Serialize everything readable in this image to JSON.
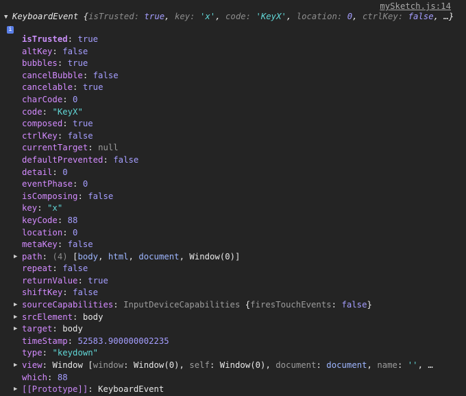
{
  "source_link": "mySketch.js:14",
  "summary": {
    "type": "KeyboardEvent",
    "open": "{",
    "entries": [
      {
        "k": "isTrusted",
        "v": "true",
        "cls": "bool"
      },
      {
        "k": "key",
        "v": "'x'",
        "cls": "str"
      },
      {
        "k": "code",
        "v": "'KeyX'",
        "cls": "str"
      },
      {
        "k": "location",
        "v": "0",
        "cls": "num"
      },
      {
        "k": "ctrlKey",
        "v": "false",
        "cls": "bool"
      }
    ],
    "ellipsis": "…}",
    "info": "i"
  },
  "rows": [
    {
      "key": "isTrusted",
      "own": true,
      "parts": [
        {
          "t": "true",
          "c": "bool"
        }
      ]
    },
    {
      "key": "altKey",
      "parts": [
        {
          "t": "false",
          "c": "bool"
        }
      ]
    },
    {
      "key": "bubbles",
      "parts": [
        {
          "t": "true",
          "c": "bool"
        }
      ]
    },
    {
      "key": "cancelBubble",
      "parts": [
        {
          "t": "false",
          "c": "bool"
        }
      ]
    },
    {
      "key": "cancelable",
      "parts": [
        {
          "t": "true",
          "c": "bool"
        }
      ]
    },
    {
      "key": "charCode",
      "parts": [
        {
          "t": "0",
          "c": "num"
        }
      ]
    },
    {
      "key": "code",
      "parts": [
        {
          "t": "\"KeyX\"",
          "c": "str"
        }
      ]
    },
    {
      "key": "composed",
      "parts": [
        {
          "t": "true",
          "c": "bool"
        }
      ]
    },
    {
      "key": "ctrlKey",
      "parts": [
        {
          "t": "false",
          "c": "bool"
        }
      ]
    },
    {
      "key": "currentTarget",
      "parts": [
        {
          "t": "null",
          "c": "null"
        }
      ]
    },
    {
      "key": "defaultPrevented",
      "parts": [
        {
          "t": "false",
          "c": "bool"
        }
      ]
    },
    {
      "key": "detail",
      "parts": [
        {
          "t": "0",
          "c": "num"
        }
      ]
    },
    {
      "key": "eventPhase",
      "parts": [
        {
          "t": "0",
          "c": "num"
        }
      ]
    },
    {
      "key": "isComposing",
      "parts": [
        {
          "t": "false",
          "c": "bool"
        }
      ]
    },
    {
      "key": "key",
      "parts": [
        {
          "t": "\"x\"",
          "c": "str"
        }
      ]
    },
    {
      "key": "keyCode",
      "parts": [
        {
          "t": "88",
          "c": "num"
        }
      ]
    },
    {
      "key": "location",
      "parts": [
        {
          "t": "0",
          "c": "num"
        }
      ]
    },
    {
      "key": "metaKey",
      "parts": [
        {
          "t": "false",
          "c": "bool"
        }
      ]
    },
    {
      "key": "path",
      "expandable": true,
      "parts": [
        {
          "t": "(4) ",
          "c": "meta"
        },
        {
          "t": "[",
          "c": "punc"
        },
        {
          "t": "body",
          "c": "lnk"
        },
        {
          "t": ", ",
          "c": "punc"
        },
        {
          "t": "html",
          "c": "lnk"
        },
        {
          "t": ", ",
          "c": "punc"
        },
        {
          "t": "document",
          "c": "lnk"
        },
        {
          "t": ", ",
          "c": "punc"
        },
        {
          "t": "Window(0)",
          "c": "obj"
        },
        {
          "t": "]",
          "c": "punc"
        }
      ]
    },
    {
      "key": "repeat",
      "parts": [
        {
          "t": "false",
          "c": "bool"
        }
      ]
    },
    {
      "key": "returnValue",
      "parts": [
        {
          "t": "true",
          "c": "bool"
        }
      ]
    },
    {
      "key": "shiftKey",
      "parts": [
        {
          "t": "false",
          "c": "bool"
        }
      ]
    },
    {
      "key": "sourceCapabilities",
      "expandable": true,
      "parts": [
        {
          "t": "InputDeviceCapabilities ",
          "c": "objkey"
        },
        {
          "t": "{",
          "c": "punc"
        },
        {
          "t": "firesTouchEvents",
          "c": "objkey"
        },
        {
          "t": ": ",
          "c": "punc"
        },
        {
          "t": "false",
          "c": "bool"
        },
        {
          "t": "}",
          "c": "punc"
        }
      ]
    },
    {
      "key": "srcElement",
      "expandable": true,
      "parts": [
        {
          "t": "body",
          "c": "obj"
        }
      ]
    },
    {
      "key": "target",
      "expandable": true,
      "parts": [
        {
          "t": "body",
          "c": "obj"
        }
      ]
    },
    {
      "key": "timeStamp",
      "parts": [
        {
          "t": "52583.900000002235",
          "c": "num"
        }
      ]
    },
    {
      "key": "type",
      "parts": [
        {
          "t": "\"keydown\"",
          "c": "str"
        }
      ]
    },
    {
      "key": "view",
      "expandable": true,
      "parts": [
        {
          "t": "Window ",
          "c": "obj"
        },
        {
          "t": "[",
          "c": "punc"
        },
        {
          "t": "window",
          "c": "objkey"
        },
        {
          "t": ": ",
          "c": "punc"
        },
        {
          "t": "Window(0)",
          "c": "obj"
        },
        {
          "t": ", ",
          "c": "punc"
        },
        {
          "t": "self",
          "c": "objkey"
        },
        {
          "t": ": ",
          "c": "punc"
        },
        {
          "t": "Window(0)",
          "c": "obj"
        },
        {
          "t": ", ",
          "c": "punc"
        },
        {
          "t": "document",
          "c": "objkey"
        },
        {
          "t": ": ",
          "c": "punc"
        },
        {
          "t": "document",
          "c": "lnk"
        },
        {
          "t": ", ",
          "c": "punc"
        },
        {
          "t": "name",
          "c": "objkey"
        },
        {
          "t": ": ",
          "c": "punc"
        },
        {
          "t": "''",
          "c": "str"
        },
        {
          "t": ", ",
          "c": "punc"
        },
        {
          "t": "…",
          "c": "punc"
        }
      ]
    },
    {
      "key": "which",
      "parts": [
        {
          "t": "88",
          "c": "num"
        }
      ]
    },
    {
      "key": "[[Prototype]]",
      "expandable": true,
      "dim": true,
      "parts": [
        {
          "t": "KeyboardEvent",
          "c": "obj"
        }
      ]
    }
  ]
}
